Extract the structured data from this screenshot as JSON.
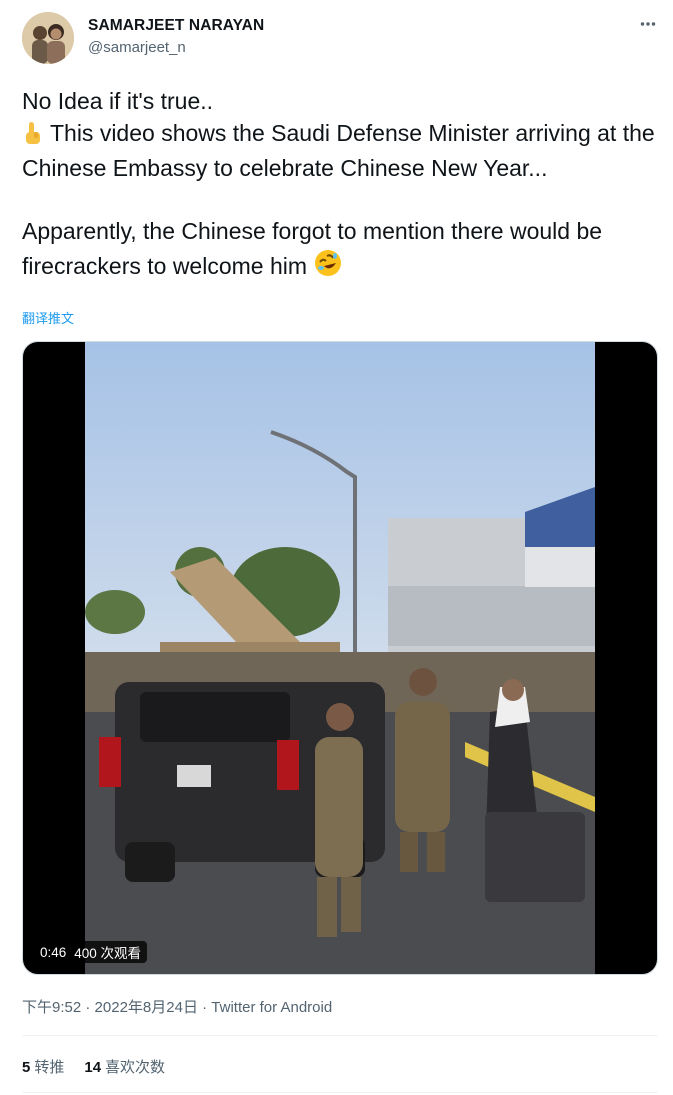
{
  "author": {
    "name": "SAMARJEET NARAYAN",
    "handle": "@samarjeet_n"
  },
  "tweet": {
    "line1": "No Idea if it's true..",
    "line2": "This video shows the Saudi Defense Minister arriving at the Chinese Embassy to celebrate Chinese New Year...",
    "line3": "Apparently, the Chinese forgot to mention there would be firecrackers to welcome him",
    "translate_label": "翻译推文"
  },
  "video": {
    "duration": "0:46",
    "views": "400 次观看"
  },
  "meta": {
    "time": "下午9:52",
    "date": "2022年8月24日",
    "separator": "·",
    "source": "Twitter for Android"
  },
  "stats": {
    "retweets_count": "5",
    "retweets_label": "转推",
    "likes_count": "14",
    "likes_label": "喜欢次数"
  },
  "icons": {
    "more": "more-horizontal-icon",
    "pointing_emoji": "index-pointing-up-emoji",
    "laughing_emoji": "rolling-on-floor-laughing-emoji"
  },
  "colors": {
    "text": "#0f1419",
    "secondary": "#536471",
    "link": "#1d9bf0"
  }
}
